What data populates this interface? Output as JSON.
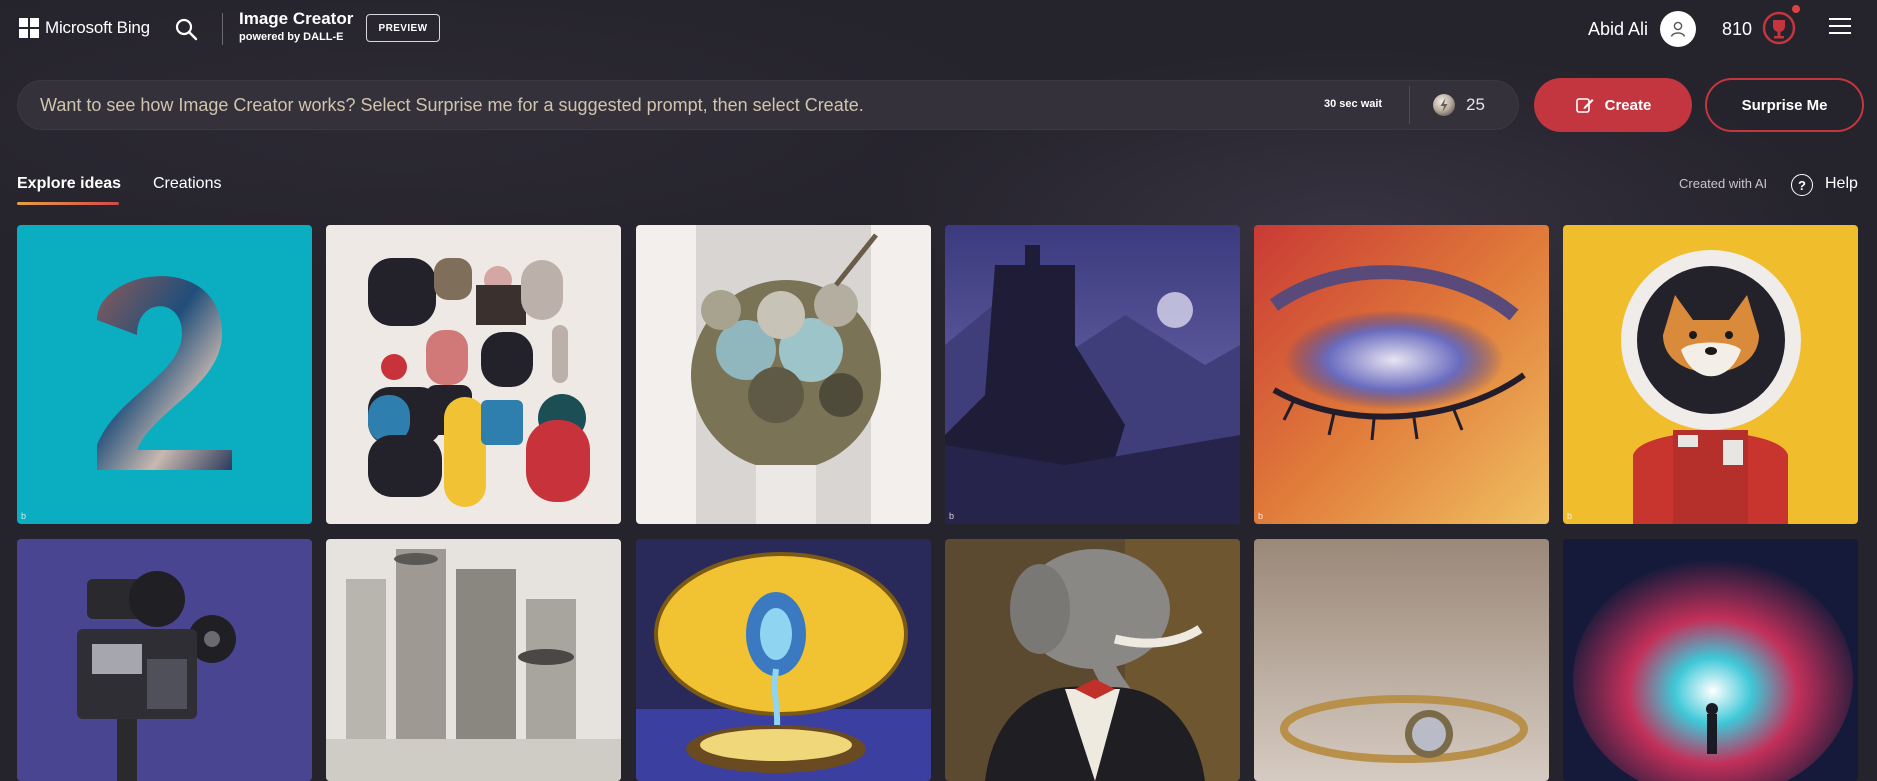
{
  "header": {
    "brand": "Microsoft Bing",
    "app_title": "Image Creator",
    "app_subtitle": "powered by DALL-E",
    "badge": "PREVIEW",
    "user_name": "Abid Ali",
    "points": "810"
  },
  "prompt": {
    "placeholder": "Want to see how Image Creator works? Select Surprise me for a suggested prompt, then select Create.",
    "value": "",
    "wait_label": "30 sec wait",
    "boosts": "25",
    "create_label": "Create",
    "surprise_label": "Surprise Me"
  },
  "tabs": {
    "explore": "Explore ideas",
    "creations": "Creations",
    "active": "explore"
  },
  "meta_links": {
    "created_with_ai": "Created with AI",
    "help": "Help",
    "help_glyph": "?"
  },
  "gallery": {
    "mark": "b",
    "items": [
      {
        "subject": "number two collage",
        "bg": "#0aaec0"
      },
      {
        "subject": "abstract shapes",
        "bg": "#efe9e6"
      },
      {
        "subject": "succulent bouquet",
        "bg": "#f2efec"
      },
      {
        "subject": "dark castle on mountain",
        "bg": "#2f2c5a"
      },
      {
        "subject": "colorful eye makeup",
        "bg": "#c93a35"
      },
      {
        "subject": "shiba astronaut",
        "bg": "#f0bd2c"
      },
      {
        "subject": "film projector",
        "bg": "#4a4590"
      },
      {
        "subject": "foggy city with ufos",
        "bg": "#e6e3df"
      },
      {
        "subject": "surreal lemon",
        "bg": "#2a2a5a"
      },
      {
        "subject": "elephant in tuxedo",
        "bg": "#5b4930"
      },
      {
        "subject": "gold ring",
        "bg": "#b9a79a"
      },
      {
        "subject": "nebula figure",
        "bg": "#161a3a"
      }
    ]
  },
  "colors": {
    "background": "#25232c",
    "accent": "#c3363f",
    "prompt_text": "#cfc4ad"
  },
  "icons": [
    "windows-logo-icon",
    "search-icon",
    "user-avatar-icon",
    "rewards-trophy-icon",
    "hamburger-menu-icon",
    "boost-coin-icon",
    "create-pencil-icon",
    "help-icon"
  ]
}
